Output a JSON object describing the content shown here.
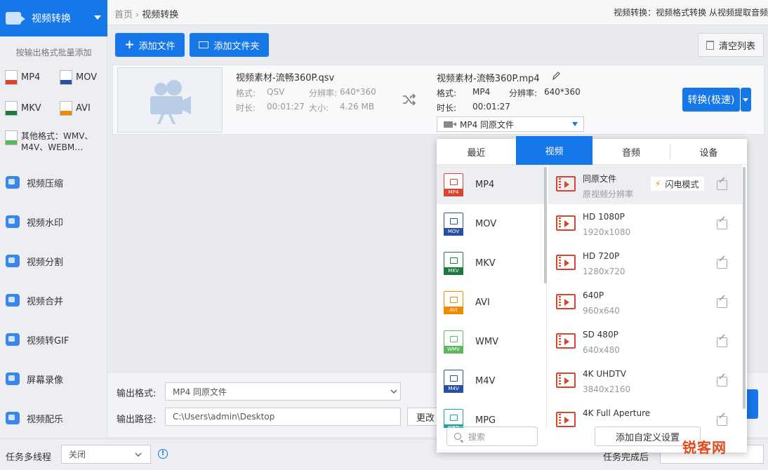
{
  "sidebar": {
    "header": "视频转换",
    "hint": "按输出格式批量添加",
    "formats": [
      {
        "label": "MP4",
        "color": "#d9442c"
      },
      {
        "label": "MOV",
        "color": "#2b4fa0"
      },
      {
        "label": "MKV",
        "color": "#1e7a3c"
      },
      {
        "label": "AVI",
        "color": "#f08a00"
      }
    ],
    "other_formats": "其他格式：WMV、M4V、WEBM…",
    "tools": [
      "视频压缩",
      "视频水印",
      "视频分割",
      "视频合并",
      "视频转GIF",
      "屏幕录像",
      "视频配乐"
    ]
  },
  "topbar": {
    "breadcrumb_home": "首页",
    "breadcrumb_sep": "›",
    "breadcrumb_current": "视频转换",
    "description": "视频转换：视频格式转换 从视频提取音频"
  },
  "toolbar": {
    "add_file": "添加文件",
    "add_folder": "添加文件夹",
    "clear_list": "清空列表"
  },
  "file": {
    "source_name": "视频素材-流畅360P.qsv",
    "source_format_label": "格式:",
    "source_format": "QSV",
    "source_res_label": "分辨率:",
    "source_res": "640*360",
    "source_dur_label": "时长:",
    "source_dur": "00:01:27",
    "source_size_label": "大小:",
    "source_size": "4.26 MB",
    "target_name": "视频素材-流畅360P.mp4",
    "target_format_label": "格式:",
    "target_format": "MP4",
    "target_res_label": "分辨率:",
    "target_res": "640*360",
    "target_dur_label": "时长:",
    "target_dur": "00:01:27",
    "target_select": "MP4  同原文件",
    "convert_button": "转换(极速)"
  },
  "output": {
    "format_label": "输出格式:",
    "format_value": "MP4  同原文件",
    "path_label": "输出路径:",
    "path_value": "C:\\Users\\admin\\Desktop",
    "change_button": "更改"
  },
  "statusbar": {
    "multithread_label": "任务多线程",
    "multithread_value": "关闭",
    "after_done_label": "任务完成后"
  },
  "popup": {
    "tabs": [
      "最近",
      "视频",
      "音频",
      "设备"
    ],
    "active_tab": "视频",
    "formats": [
      {
        "label": "MP4",
        "color": "#d9442c"
      },
      {
        "label": "MOV",
        "color": "#2b4fa0"
      },
      {
        "label": "MKV",
        "color": "#1e7a3c"
      },
      {
        "label": "AVI",
        "color": "#f08a00"
      },
      {
        "label": "WMV",
        "color": "#5bb85c"
      },
      {
        "label": "M4V",
        "color": "#2b4fa0"
      },
      {
        "label": "MPG",
        "color": "#1aa3a3"
      }
    ],
    "presets": [
      {
        "name": "同原文件",
        "sub": "原视频分辨率"
      },
      {
        "name": "HD 1080P",
        "sub": "1920x1080"
      },
      {
        "name": "HD 720P",
        "sub": "1280x720"
      },
      {
        "name": "640P",
        "sub": "960x640"
      },
      {
        "name": "SD 480P",
        "sub": "640x480"
      },
      {
        "name": "4K UHDTV",
        "sub": "3840x2160"
      },
      {
        "name": "4K Full Aperture",
        "sub": ""
      }
    ],
    "flash_mode": "闪电模式",
    "search_placeholder": "搜索",
    "custom_button": "添加自定义设置"
  },
  "watermark": "锐客网"
}
